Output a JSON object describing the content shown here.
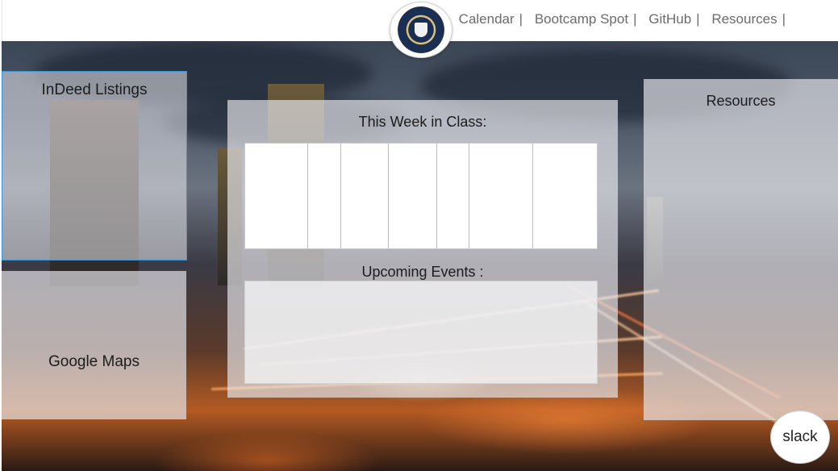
{
  "header": {
    "logo_icon": "university-seal-icon",
    "nav": [
      {
        "label": "Calendar"
      },
      {
        "label": "Bootcamp Spot"
      },
      {
        "label": "GitHub"
      },
      {
        "label": "Resources"
      }
    ],
    "separator": "|"
  },
  "panels": {
    "indeed": {
      "title": "InDeed Listings"
    },
    "google_maps": {
      "title": "Google Maps"
    },
    "resources": {
      "title": "Resources"
    },
    "center": {
      "week_title": "This Week in Class:",
      "events_title": "Upcoming Events :"
    }
  },
  "slack": {
    "label": "slack"
  },
  "colors": {
    "panel_bg": "#e8e8ec",
    "header_bg": "#ffffff",
    "nav_text": "#6b6b6b",
    "indeed_border": "#3d95d8"
  }
}
